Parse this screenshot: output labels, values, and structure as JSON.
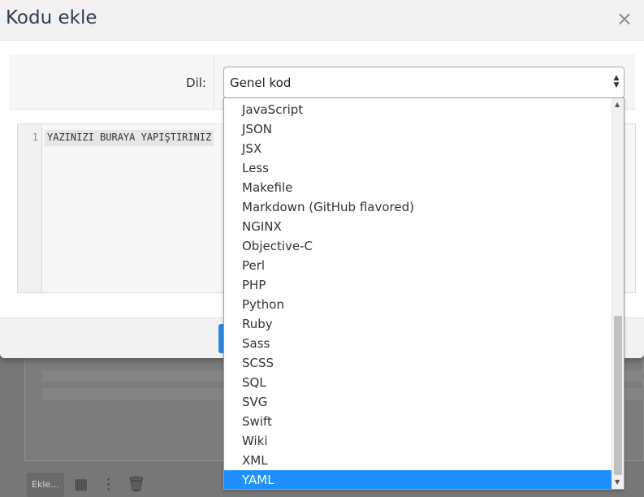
{
  "background": {
    "add_button_label": "Ekle...",
    "grid_icon": "grid-icon",
    "more_icon": "more-vert-icon",
    "trash_icon": "trash-icon"
  },
  "modal": {
    "title": "Kodu ekle",
    "close_glyph": "×",
    "language_label": "Dil:",
    "language_selected": "Genel kod",
    "code_line_number": "1",
    "code_placeholder": "YAZINIZI BURAYA YAPIŞTIRINIZ"
  },
  "dropdown": {
    "items": [
      "JavaScript",
      "JSON",
      "JSX",
      "Less",
      "Makefile",
      "Markdown (GitHub flavored)",
      "NGINX",
      "Objective-C",
      "Perl",
      "PHP",
      "Python",
      "Ruby",
      "Sass",
      "SCSS",
      "SQL",
      "SVG",
      "Swift",
      "Wiki",
      "XML",
      "YAML"
    ],
    "selected": "YAML",
    "scroll_position": 0.78
  },
  "colors": {
    "accent": "#1e90ff",
    "title": "#2c3e50",
    "overlay": "#777777"
  }
}
